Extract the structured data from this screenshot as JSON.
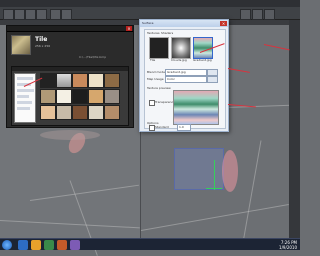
{
  "app": {
    "menu_text": ""
  },
  "browser": {
    "title": "",
    "preview_title": "Tile",
    "preview_sub": "256 x 256",
    "info": "C:\\...\\Tile\\Mix.bmp"
  },
  "dialog": {
    "title": "Surface",
    "tabs": [
      "Textures",
      "Shaders"
    ],
    "textures": [
      {
        "label": "Tile"
      },
      {
        "label": "Clouds.jpg"
      },
      {
        "label": "Gradient.jpg"
      }
    ],
    "field1_label": "Blend mode",
    "field1_value": "Gradient.jpg",
    "field2_label": "Map Usage",
    "field2_value": "Color",
    "section_label": "Texture preview",
    "checkbox_label": "Transparency",
    "bottom_label": "Options",
    "bottom_field": "Standard",
    "bottom_num": "1.0"
  },
  "taskbar": {
    "time": "7:26 PM",
    "date": "1/9/2010"
  },
  "colors": {
    "arrow": "#d8333e",
    "accent": "#1b5bb5"
  }
}
